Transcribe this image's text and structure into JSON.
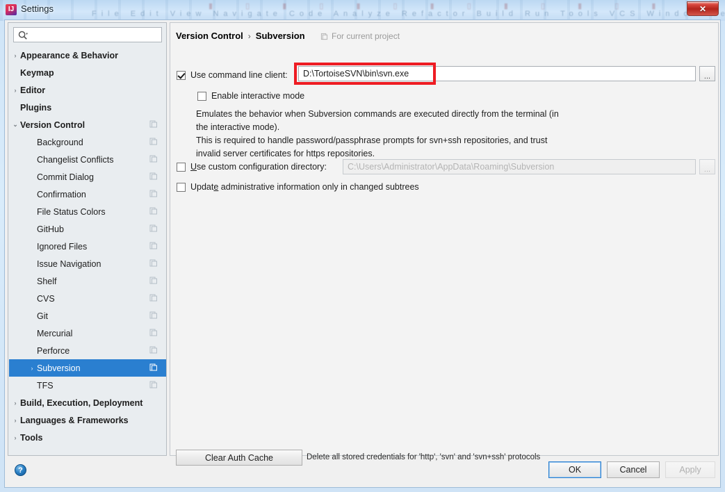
{
  "window": {
    "title": "Settings",
    "app_icon": "intellij-idea-icon",
    "close_label": "✕"
  },
  "search": {
    "value": "",
    "placeholder": "",
    "icon": "search-icon"
  },
  "sidebar": {
    "items": [
      {
        "label": "Appearance & Behavior",
        "level": 0,
        "arrow": "›",
        "bold": true,
        "selected": false,
        "icon": ""
      },
      {
        "label": "Keymap",
        "level": 0,
        "arrow": "",
        "bold": true,
        "selected": false,
        "icon": ""
      },
      {
        "label": "Editor",
        "level": 0,
        "arrow": "›",
        "bold": true,
        "selected": false,
        "icon": ""
      },
      {
        "label": "Plugins",
        "level": 0,
        "arrow": "",
        "bold": true,
        "selected": false,
        "icon": ""
      },
      {
        "label": "Version Control",
        "level": 0,
        "arrow": "⌄",
        "bold": true,
        "selected": false,
        "icon": "project-scope-icon"
      },
      {
        "label": "Background",
        "level": 1,
        "arrow": "",
        "bold": false,
        "selected": false,
        "icon": "project-scope-icon"
      },
      {
        "label": "Changelist Conflicts",
        "level": 1,
        "arrow": "",
        "bold": false,
        "selected": false,
        "icon": "project-scope-icon"
      },
      {
        "label": "Commit Dialog",
        "level": 1,
        "arrow": "",
        "bold": false,
        "selected": false,
        "icon": "project-scope-icon"
      },
      {
        "label": "Confirmation",
        "level": 1,
        "arrow": "",
        "bold": false,
        "selected": false,
        "icon": "project-scope-icon"
      },
      {
        "label": "File Status Colors",
        "level": 1,
        "arrow": "",
        "bold": false,
        "selected": false,
        "icon": "project-scope-icon"
      },
      {
        "label": "GitHub",
        "level": 1,
        "arrow": "",
        "bold": false,
        "selected": false,
        "icon": "project-scope-icon"
      },
      {
        "label": "Ignored Files",
        "level": 1,
        "arrow": "",
        "bold": false,
        "selected": false,
        "icon": "project-scope-icon"
      },
      {
        "label": "Issue Navigation",
        "level": 1,
        "arrow": "",
        "bold": false,
        "selected": false,
        "icon": "project-scope-icon"
      },
      {
        "label": "Shelf",
        "level": 1,
        "arrow": "",
        "bold": false,
        "selected": false,
        "icon": "project-scope-icon"
      },
      {
        "label": "CVS",
        "level": 1,
        "arrow": "",
        "bold": false,
        "selected": false,
        "icon": "project-scope-icon"
      },
      {
        "label": "Git",
        "level": 1,
        "arrow": "",
        "bold": false,
        "selected": false,
        "icon": "project-scope-icon"
      },
      {
        "label": "Mercurial",
        "level": 1,
        "arrow": "",
        "bold": false,
        "selected": false,
        "icon": "project-scope-icon"
      },
      {
        "label": "Perforce",
        "level": 1,
        "arrow": "",
        "bold": false,
        "selected": false,
        "icon": "project-scope-icon"
      },
      {
        "label": "Subversion",
        "level": 1,
        "arrow": "›",
        "bold": false,
        "selected": true,
        "icon": "project-scope-icon"
      },
      {
        "label": "TFS",
        "level": 1,
        "arrow": "",
        "bold": false,
        "selected": false,
        "icon": "project-scope-icon"
      },
      {
        "label": "Build, Execution, Deployment",
        "level": 0,
        "arrow": "›",
        "bold": true,
        "selected": false,
        "icon": ""
      },
      {
        "label": "Languages & Frameworks",
        "level": 0,
        "arrow": "›",
        "bold": true,
        "selected": false,
        "icon": ""
      },
      {
        "label": "Tools",
        "level": 0,
        "arrow": "›",
        "bold": true,
        "selected": false,
        "icon": ""
      }
    ]
  },
  "content": {
    "breadcrumb": {
      "root": "Version Control",
      "separator": "›",
      "leaf": "Subversion"
    },
    "scope_note": "For current project",
    "scope_icon": "project-scope-icon",
    "use_command_line_client": {
      "label": "Use command line client:",
      "checked": true,
      "path_value": "D:\\TortoiseSVN\\bin\\svn.exe",
      "browse_label": "..."
    },
    "enable_interactive_mode": {
      "label": "Enable interactive mode",
      "checked": false
    },
    "description": [
      "Emulates the behavior when Subversion commands are executed directly from the terminal (in",
      "the interactive mode).",
      "This is required to handle password/passphrase prompts for svn+ssh repositories, and trust",
      "invalid server certificates for https repositories."
    ],
    "use_custom_configuration_directory": {
      "label_prefix": "U",
      "label_rest": "se custom configuration directory:",
      "checked": false,
      "path_value": "C:\\Users\\Administrator\\AppData\\Roaming\\Subversion",
      "browse_label": "..."
    },
    "update_administrative_information": {
      "label_a": "Updat",
      "label_mn": "e",
      "label_b": " administrative information only in changed subtrees",
      "checked": false
    },
    "clear_auth_cache": {
      "button_label": "Clear Auth Cache",
      "note": "Delete all stored credentials for 'http', 'svn' and 'svn+ssh' protocols"
    }
  },
  "footer": {
    "help_label": "?",
    "ok_label": "OK",
    "cancel_label": "Cancel",
    "apply_label": "Apply"
  },
  "annotation": {
    "highlight_color": "#ee1c23",
    "target": "command-line-client-path-field"
  },
  "colors": {
    "selection_blue": "#2a7fd0",
    "titlebar_blue": "#cfe4f7",
    "close_red": "#b3251d",
    "panel_gray": "#f3f3f3",
    "tree_gray": "#e9edf0"
  }
}
